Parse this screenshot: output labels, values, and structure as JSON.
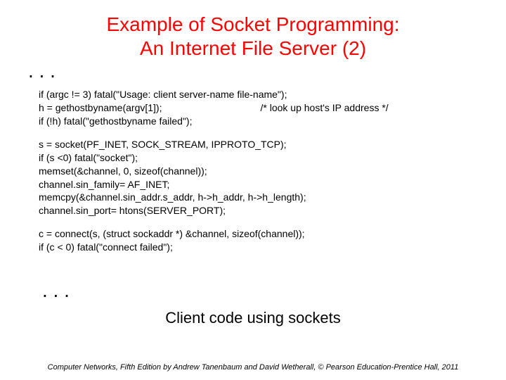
{
  "title_line1": "Example of Socket Programming:",
  "title_line2": "An Internet File Server (2)",
  "ellipsis": ". . .",
  "code": {
    "l1": "if (argc != 3) fatal(\"Usage: client server-name file-name\");",
    "l2_left": "h = gethostbyname(argv[1]);",
    "l2_right": "/* look up host's IP address */",
    "l3": "if (!h) fatal(\"gethostbyname failed\");",
    "l4": "s = socket(PF_INET, SOCK_STREAM, IPPROTO_TCP);",
    "l5": "if (s <0) fatal(\"socket\");",
    "l6": "memset(&channel, 0, sizeof(channel));",
    "l7": "channel.sin_family= AF_INET;",
    "l8": "memcpy(&channel.sin_addr.s_addr, h->h_addr, h->h_length);",
    "l9": "channel.sin_port= htons(SERVER_PORT);",
    "l10": "c = connect(s, (struct sockaddr *) &channel, sizeof(channel));",
    "l11": "if (c < 0) fatal(\"connect failed\");"
  },
  "caption": "Client code using sockets",
  "footer": "Computer Networks, Fifth Edition by Andrew Tanenbaum and David Wetherall, © Pearson Education-Prentice Hall, 2011"
}
